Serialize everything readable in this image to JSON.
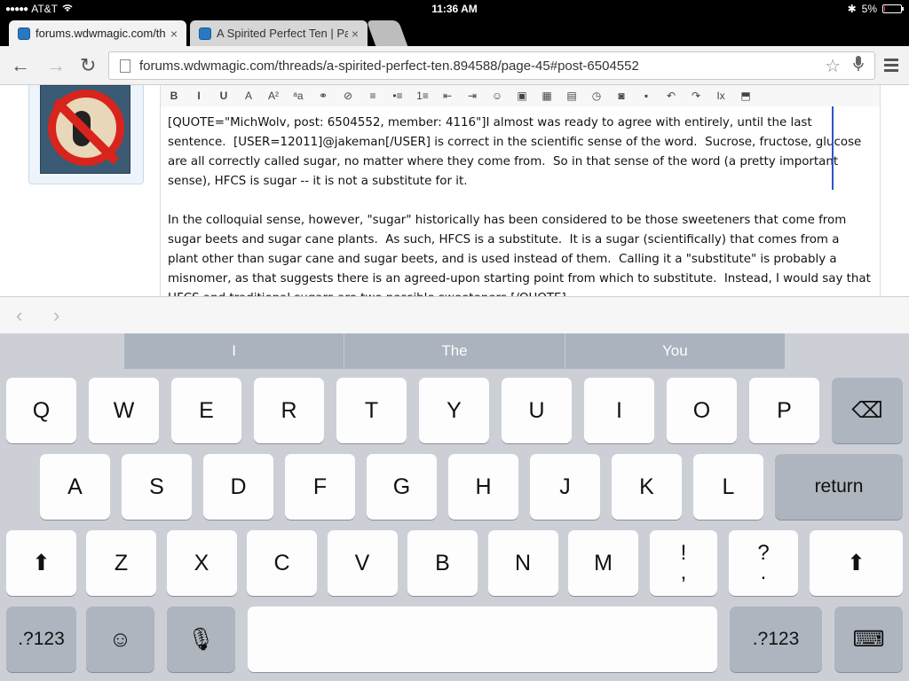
{
  "status_bar": {
    "signal": "●●●●●",
    "carrier": "AT&T",
    "wifi_icon": "wifi-icon",
    "time": "11:36 AM",
    "bluetooth_icon": "✱",
    "battery_pct": "5%",
    "battery_level": 0.05
  },
  "tabs": [
    {
      "title": "forums.wdwmagic.com/th",
      "close": "×"
    },
    {
      "title": "A Spirited Perfect Ten | Pa",
      "close": "×"
    }
  ],
  "toolbar": {
    "back": "←",
    "forward": "→",
    "reload": "↻",
    "url": "forums.wdwmagic.com/threads/a-spirited-perfect-ten.894588/page-45#post-6504552",
    "star": "☆",
    "mic": "🎙"
  },
  "editor_toolbar": [
    "B",
    "I",
    "U",
    "A",
    "A²",
    "ᵃa",
    "⚭",
    "⊘",
    "≡",
    "•≡",
    "1≡",
    "⇤",
    "⇥",
    "☺",
    "▣",
    "▦",
    "▤",
    "◷",
    "◙",
    "▪",
    "↶",
    "↷",
    "Ix",
    "⬒"
  ],
  "editor": {
    "paragraph1": "[QUOTE=\"MichWolv, post: 6504552, member: 4116\"]I almost was ready to agree with entirely, until the last sentence.  [USER=12011]@jakeman[/USER] is correct in the scientific sense of the word.  Sucrose, fructose, glucose are all correctly called sugar, no matter where they come from.  So in that sense of the word (a pretty important sense), HFCS is sugar -- it is not a substitute for it.",
    "paragraph2": "In the colloquial sense, however, \"sugar\" historically has been considered to be those sweeteners that come from sugar beets and sugar cane plants.  As such, HFCS is a substitute.  It is a sugar (scientifically) that comes from a plant other than sugar cane and sugar beets, and is used instead of them.  Calling it a \"substitute\" is probably a misnomer, as that suggests there is an agreed-upon starting point from which to substitute.  Instead, I would say that HFCS and traditional sugars are two possible sweeteners.[/QUOTE]"
  },
  "accessory": {
    "prev": "‹",
    "next": "›"
  },
  "suggestions": [
    "I",
    "The",
    "You"
  ],
  "keyboard": {
    "row1": [
      "Q",
      "W",
      "E",
      "R",
      "T",
      "Y",
      "U",
      "I",
      "O",
      "P"
    ],
    "row2": [
      "A",
      "S",
      "D",
      "F",
      "G",
      "H",
      "J",
      "K",
      "L"
    ],
    "row3": [
      "Z",
      "X",
      "C",
      "V",
      "B",
      "N",
      "M"
    ],
    "return": "return",
    "numbers": ".?123",
    "backspace_icon": "⌫",
    "shift_icon": "⬆",
    "emoji_icon": "☺",
    "mic_icon": "🎙",
    "hide_keyboard_icon": "⌨",
    "punct1_top": "!",
    "punct1_bottom": ",",
    "punct2_top": "?",
    "punct2_bottom": "."
  }
}
